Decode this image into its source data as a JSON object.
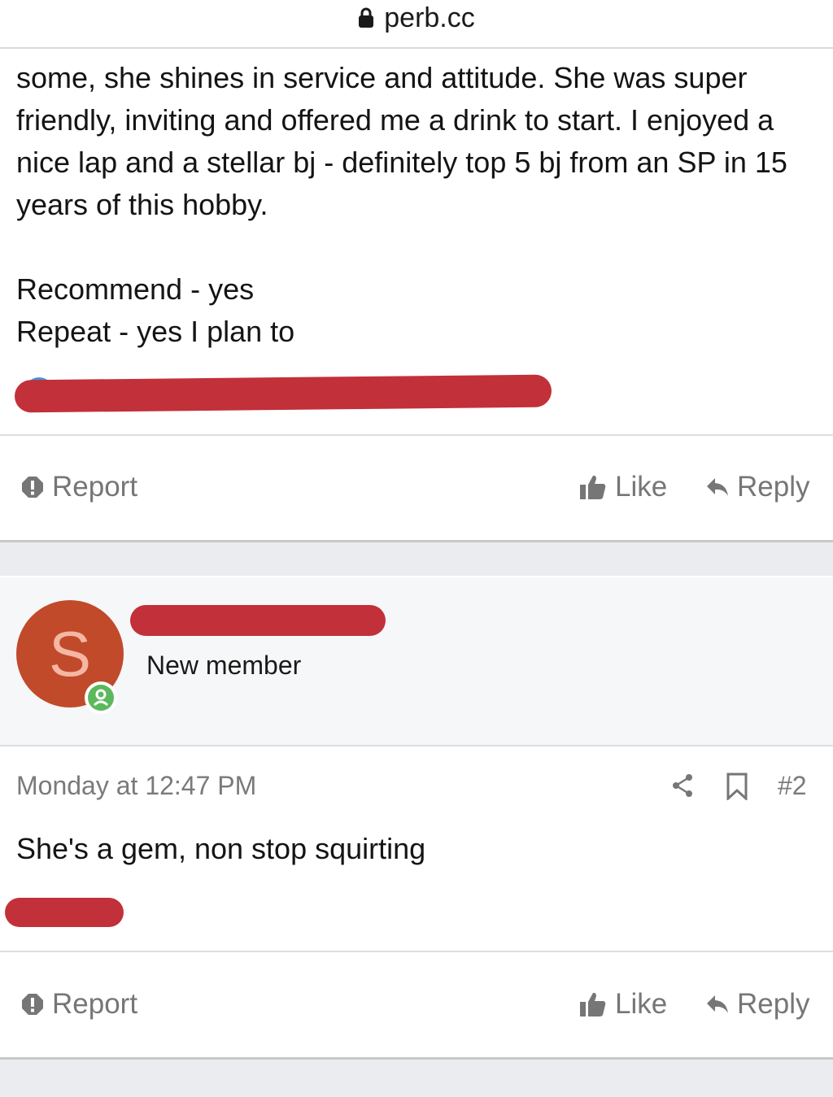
{
  "browser": {
    "url": "perb.cc"
  },
  "post1": {
    "paragraphs": [
      "some, she shines in service and attitude. She was super friendly, inviting and offered me a drink to start. I enjoyed a nice lap and a stellar bj - definitely top 5 bj from an SP in 15 years of this hobby.",
      "Recommend - yes",
      "Repeat - yes I plan to"
    ],
    "actions": {
      "report": "Report",
      "like": "Like",
      "reply": "Reply"
    }
  },
  "post2": {
    "avatar_letter": "S",
    "user_title": "New member",
    "date": "Monday at 12:47 PM",
    "post_number": "#2",
    "body": "She's a gem, non stop squirting",
    "actions": {
      "report": "Report",
      "like": "Like",
      "reply": "Reply"
    }
  },
  "colors": {
    "redaction": "#c2303a",
    "avatar_bg": "#c14a2b",
    "avatar_letter": "#f4b7a3",
    "online_badge": "#5cb85c",
    "action_text": "#767676"
  },
  "icons": [
    "lock-icon",
    "report-icon",
    "like-icon",
    "reply-icon",
    "user-badge-icon",
    "share-icon",
    "bookmark-icon"
  ]
}
